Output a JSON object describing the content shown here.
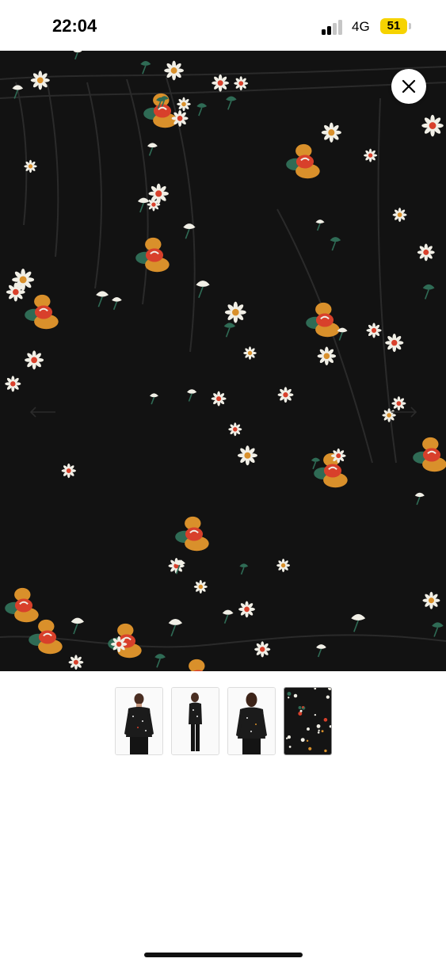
{
  "status_bar": {
    "time": "22:04",
    "network": "4G",
    "battery": "51",
    "battery_color": "#f6d300",
    "signal_icon": "cellular-signal-icon"
  },
  "viewer": {
    "close_icon": "close-icon",
    "prev_icon": "arrow-left-icon",
    "next_icon": "arrow-right-icon",
    "fabric_background": "#121212",
    "print_colors": [
      "#f1efe6",
      "#d8402b",
      "#d9902b",
      "#2f6b55"
    ]
  },
  "thumbnails": [
    {
      "name": "model-front",
      "active": false
    },
    {
      "name": "model-side",
      "active": false
    },
    {
      "name": "model-back",
      "active": false
    },
    {
      "name": "fabric-closeup",
      "active": true
    }
  ]
}
